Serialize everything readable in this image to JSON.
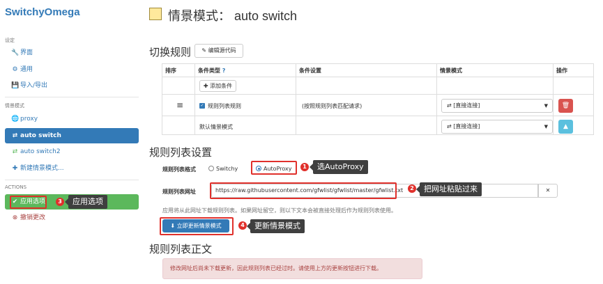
{
  "sidebar": {
    "brand": "SwitchyOmega",
    "settings_heading": "设定",
    "settings_items": [
      {
        "icon": "wrench-icon",
        "glyph": "🔧",
        "label": "界面"
      },
      {
        "icon": "gear-icon",
        "glyph": "⚙",
        "label": "通用"
      },
      {
        "icon": "floppy-icon",
        "glyph": "💾",
        "label": "导入/导出"
      }
    ],
    "profiles_heading": "情景模式",
    "profile_items": [
      {
        "icon": "globe-icon",
        "glyph": "🌐",
        "label": "proxy"
      },
      {
        "icon": "switch-arrows-icon",
        "glyph": "⇄",
        "label": "auto switch"
      },
      {
        "icon": "switch-arrows-icon",
        "glyph": "⇄",
        "label": "auto switch2"
      },
      {
        "icon": "plus-icon",
        "glyph": "✚",
        "label": "新建情景模式..."
      }
    ],
    "actions_heading": "ACTIONS",
    "apply_label": "应用选项",
    "apply_glyph": "✔",
    "discard_label": "撤销更改",
    "discard_glyph": "⊗"
  },
  "header": {
    "title": "情景模式： auto switch",
    "swatch_color": "#ffe99c"
  },
  "switch_rules": {
    "heading": "切换规则",
    "edit_source_label": "编辑源代码",
    "edit_glyph": "✎",
    "columns": [
      "排序",
      "条件类型",
      "条件设置",
      "情景模式",
      "操作"
    ],
    "help_glyph": "?",
    "add_condition_label": "添加条件",
    "rule": {
      "handle_glyph": "≡",
      "condition_type": "规则列表规则",
      "condition_value": "(按照规则列表匹配请求)",
      "profile": "[直接连接]",
      "delete_glyph": "🗑"
    },
    "default_row": {
      "label": "默认情景模式",
      "profile": "[直接连接]",
      "up_glyph": "▲"
    },
    "profile_glyph": "⇄",
    "caret_glyph": "▼"
  },
  "rule_list": {
    "heading": "规则列表设置",
    "format_label": "规则列表格式",
    "format_options": [
      "Switchy",
      "AutoProxy"
    ],
    "format_selected": "AutoProxy",
    "url_label": "规则列表网址",
    "url_value": "https://raw.githubusercontent.com/gfwlist/gfwlist/master/gfwlist.txt",
    "clear_glyph": "✕",
    "help_text": "应用将从此网址下载规则列表。如果网址留空，则以下文本会被直接处理后作为规则列表使用。",
    "update_button_label": "立即更新情景模式",
    "update_glyph": "⬇"
  },
  "rule_text": {
    "heading": "规则列表正文",
    "alert": "修改网址后尚未下载更新，因此规则列表已经过时。请使用上方的更新按钮进行下载。"
  },
  "annotations": [
    {
      "num": "1",
      "text": "选AutoProxy"
    },
    {
      "num": "2",
      "text": "把网址粘贴过来"
    },
    {
      "num": "3",
      "text": "应用选项"
    },
    {
      "num": "4",
      "text": "更新情景模式"
    }
  ],
  "colors": {
    "accent": "#337ab7",
    "success": "#5cb85c",
    "danger": "#d9534f",
    "info": "#5bc0de",
    "callout_red": "#e0302b"
  }
}
